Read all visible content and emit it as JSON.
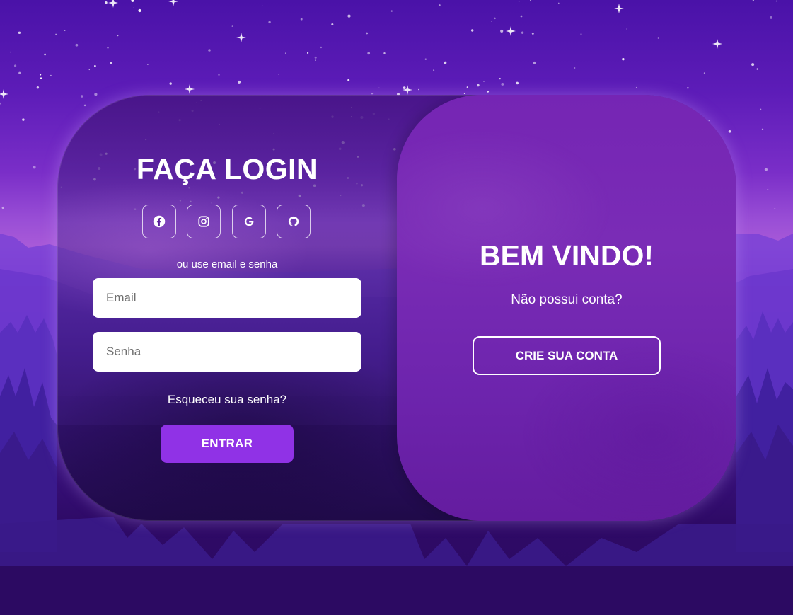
{
  "login": {
    "title": "FAÇA LOGIN",
    "social_buttons": [
      {
        "icon": "facebook-icon"
      },
      {
        "icon": "instagram-icon"
      },
      {
        "icon": "google-icon"
      },
      {
        "icon": "github-icon"
      }
    ],
    "alt_text": "ou use email e senha",
    "email_placeholder": "Email",
    "password_placeholder": "Senha",
    "forgot_label": "Esqueceu sua senha?",
    "submit_label": "ENTRAR"
  },
  "welcome": {
    "title": "BEM VINDO!",
    "subtitle": "Não possui conta?",
    "create_label": "CRIE SUA CONTA"
  },
  "colors": {
    "accent": "#9032e6",
    "panel": "#7525b4",
    "background": "#4a12a8"
  }
}
